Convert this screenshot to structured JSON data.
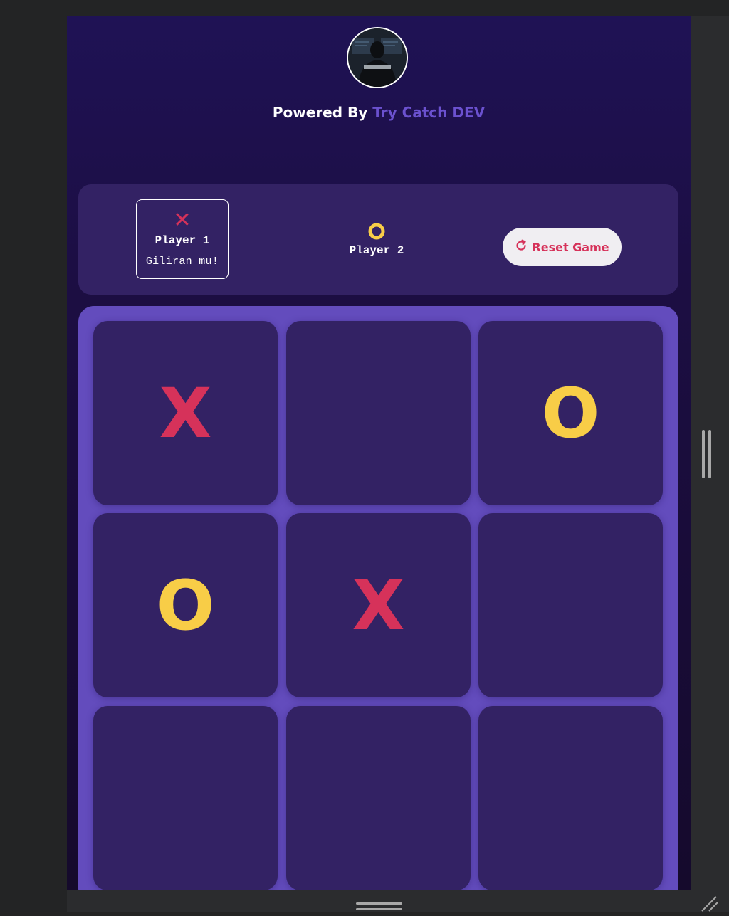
{
  "header": {
    "powered_prefix": "Powered By",
    "powered_brand": "Try Catch DEV"
  },
  "scoreboard": {
    "player1": {
      "symbol": "✕",
      "name": "Player 1",
      "status": "Giliran mu!"
    },
    "player2": {
      "symbol": "O",
      "name": "Player 2"
    },
    "reset_label": "Reset Game"
  },
  "board": {
    "cells": [
      "X",
      "",
      "O",
      "O",
      "X",
      "",
      "",
      "",
      ""
    ]
  },
  "colors": {
    "x": "#d6325a",
    "o": "#f8cd47",
    "accent": "#634cbd",
    "panel": "#332264"
  },
  "icons": {
    "reset": "reset-icon",
    "avatar": "avatar-photo"
  }
}
